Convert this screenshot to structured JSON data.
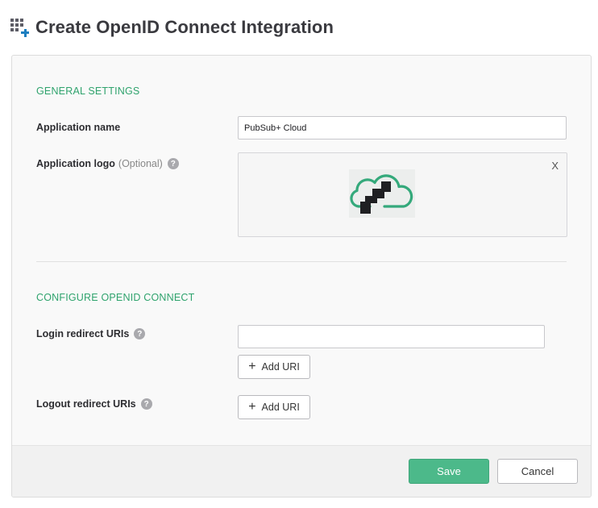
{
  "header": {
    "title": "Create OpenID Connect Integration",
    "icon": "grid-add-icon"
  },
  "general": {
    "section_title": "GENERAL SETTINGS",
    "app_name": {
      "label": "Application name",
      "value": "PubSub+ Cloud"
    },
    "app_logo": {
      "label": "Application logo",
      "optional": "(Optional)",
      "help": "?",
      "remove": "X"
    }
  },
  "oidc": {
    "section_title": "CONFIGURE OPENID CONNECT",
    "login": {
      "label": "Login redirect URIs",
      "help": "?",
      "value": "",
      "add_label": "Add URI"
    },
    "logout": {
      "label": "Logout redirect URIs",
      "help": "?",
      "add_label": "Add URI"
    }
  },
  "footer": {
    "save": "Save",
    "cancel": "Cancel"
  },
  "colors": {
    "accent": "#2fa36d",
    "save_bg": "#4cb98a",
    "plus_icon": "#1d7ebf"
  }
}
